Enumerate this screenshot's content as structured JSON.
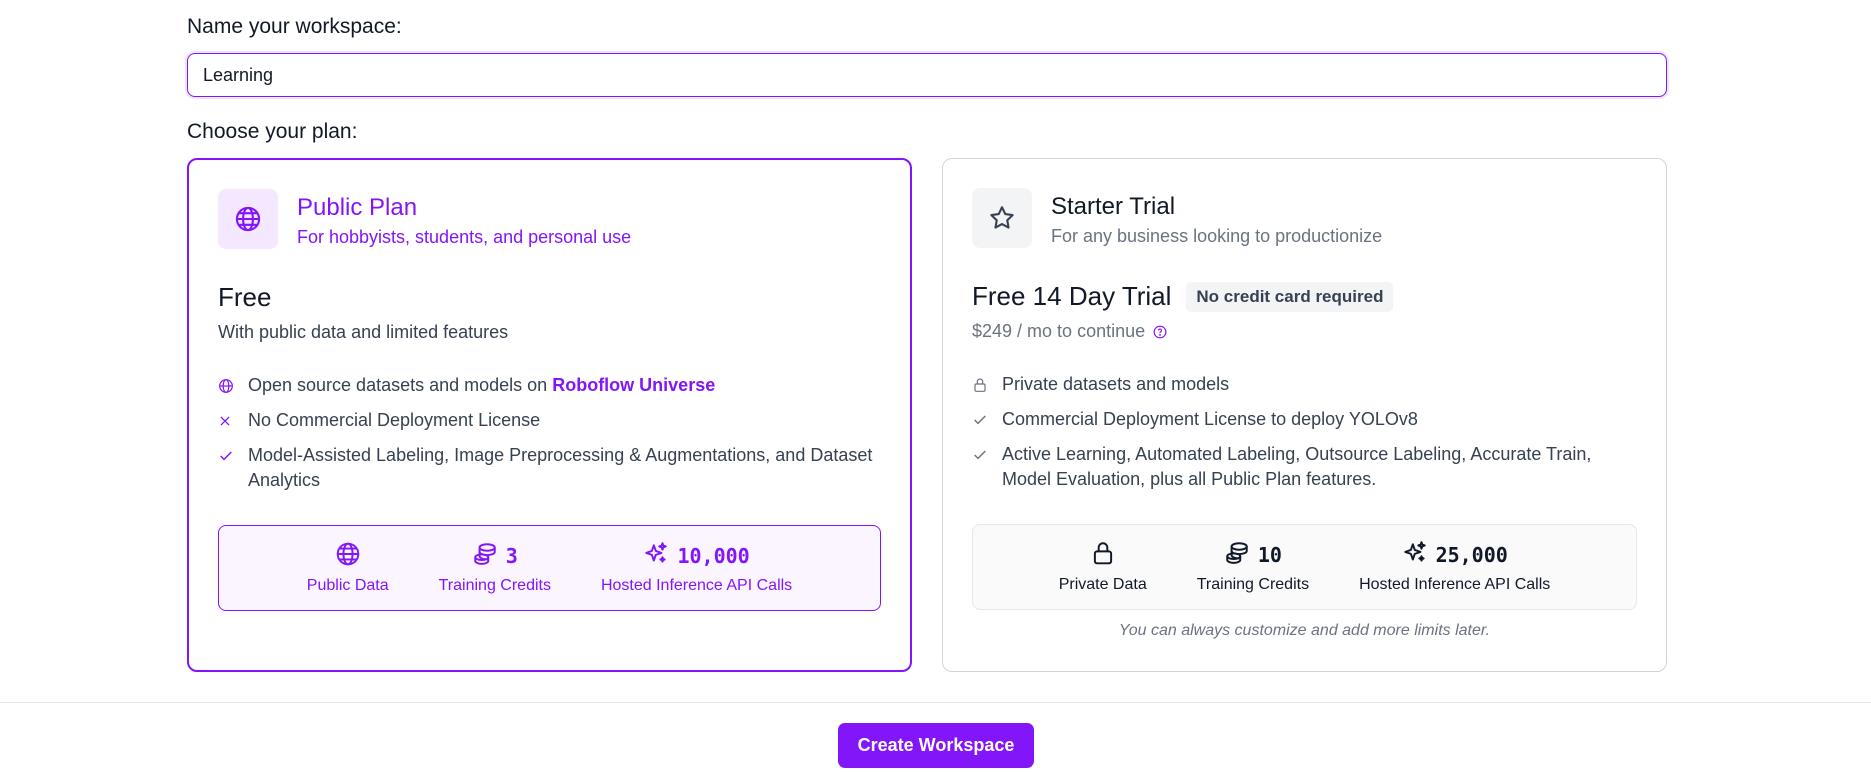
{
  "workspace": {
    "name_label": "Name your workspace:",
    "name_value": "Learning"
  },
  "plan_section": {
    "label": "Choose your plan:"
  },
  "plans": [
    {
      "icon": "globe-icon",
      "title": "Public Plan",
      "subtitle": "For hobbyists, students, and personal use",
      "price": "Free",
      "price_sub": "With public data and limited features",
      "selected": true,
      "features": [
        {
          "icon": "globe-icon",
          "text": "Open source datasets and models on ",
          "link": "Roboflow Universe"
        },
        {
          "icon": "x-icon",
          "text": "No Commercial Deployment License"
        },
        {
          "icon": "check-icon",
          "text": "Model-Assisted Labeling, Image Preprocessing & Augmentations, and Dataset Analytics"
        }
      ],
      "limits": [
        {
          "icon": "globe-icon",
          "value": "",
          "label": "Public Data"
        },
        {
          "icon": "coins-icon",
          "value": "3",
          "label": "Training Credits"
        },
        {
          "icon": "sparkles-icon",
          "value": "10,000",
          "label": "Hosted Inference API Calls"
        }
      ]
    },
    {
      "icon": "star-icon",
      "title": "Starter Trial",
      "subtitle": "For any business looking to productionize",
      "price": "Free 14 Day Trial",
      "badge": "No credit card required",
      "price_sub": "$249 / mo to continue",
      "selected": false,
      "features": [
        {
          "icon": "lock-icon",
          "text": "Private datasets and models"
        },
        {
          "icon": "check-icon",
          "text": "Commercial Deployment License to deploy YOLOv8"
        },
        {
          "icon": "check-icon",
          "text": "Active Learning, Automated Labeling, Outsource Labeling, Accurate Train, Model Evaluation, plus all Public Plan features."
        }
      ],
      "limits": [
        {
          "icon": "lock-icon",
          "value": "",
          "label": "Private Data"
        },
        {
          "icon": "coins-icon",
          "value": "10",
          "label": "Training Credits"
        },
        {
          "icon": "sparkles-icon",
          "value": "25,000",
          "label": "Hosted Inference API Calls"
        }
      ],
      "note": "You can always customize and add more limits later."
    }
  ],
  "actions": {
    "create_label": "Create Workspace"
  },
  "colors": {
    "accent": "#8315f9",
    "accent_bg": "#f3e8ff",
    "border": "#d1d5db"
  }
}
